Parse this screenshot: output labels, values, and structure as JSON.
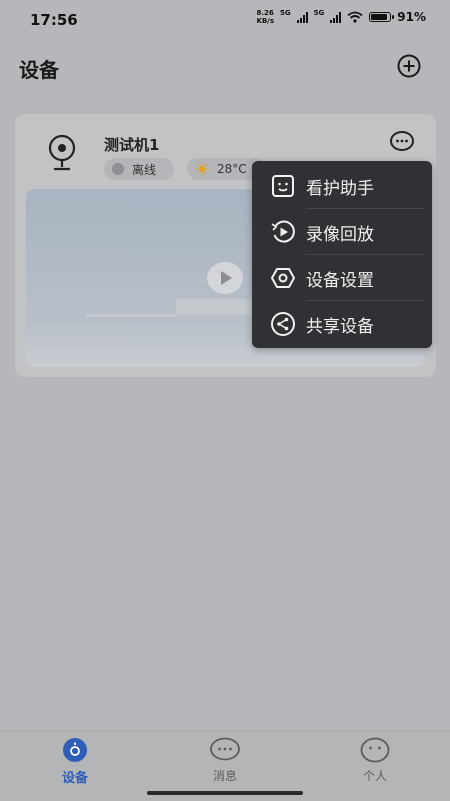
{
  "status_bar": {
    "time": "17:56",
    "net_speed_value": "8.26",
    "net_speed_unit": "KB/s",
    "network_1": "5G",
    "network_2": "5G",
    "battery": "91%"
  },
  "header": {
    "title": "设备",
    "add_icon": "plus-circle-icon"
  },
  "device": {
    "name": "测试机1",
    "status": "离线",
    "temperature": "28°C",
    "status_color": "#8d8f92",
    "weather_icon": "sun-icon"
  },
  "menu": {
    "items": [
      {
        "label": "看护助手",
        "icon": "face-icon"
      },
      {
        "label": "录像回放",
        "icon": "playback-icon"
      },
      {
        "label": "设备设置",
        "icon": "settings-hexagon-icon"
      },
      {
        "label": "共享设备",
        "icon": "share-icon"
      }
    ]
  },
  "tabs": [
    {
      "label": "设备",
      "icon": "device-icon",
      "active": true
    },
    {
      "label": "消息",
      "icon": "message-icon",
      "active": false
    },
    {
      "label": "个人",
      "icon": "profile-icon",
      "active": false
    }
  ],
  "colors": {
    "accent": "#2f5eb8",
    "menu_bg": "#2f3134",
    "sun": "#e0a21e"
  }
}
